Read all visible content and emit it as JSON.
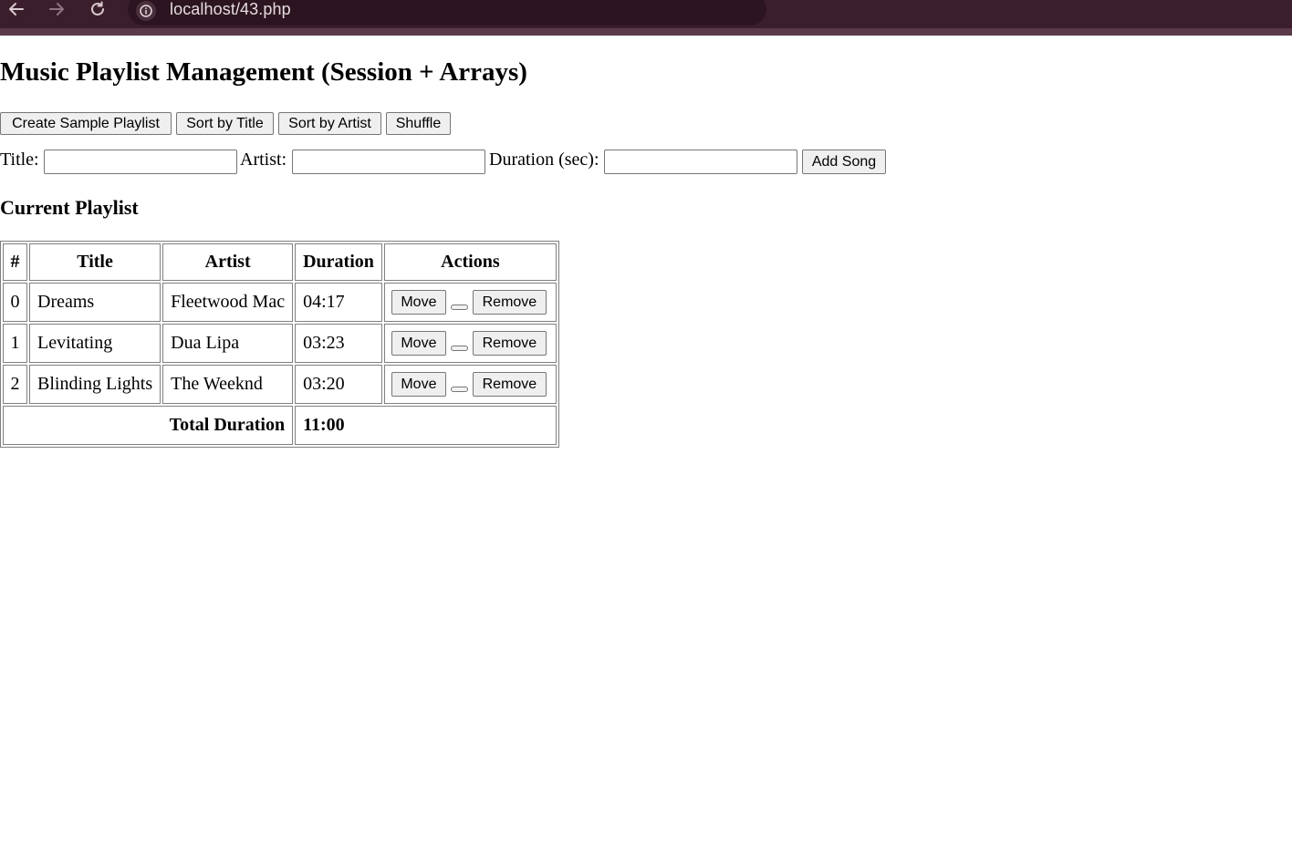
{
  "browser": {
    "url": "localhost/43.php"
  },
  "page": {
    "heading": "Music Playlist Management (Session + Arrays)",
    "toolbar": {
      "create_sample": "Create Sample Playlist",
      "sort_title": "Sort by Title",
      "sort_artist": "Sort by Artist",
      "shuffle": "Shuffle"
    },
    "form": {
      "title_label": "Title:",
      "title_value": "",
      "artist_label": "Artist:",
      "artist_value": "",
      "duration_label": "Duration (sec):",
      "duration_value": "",
      "add_label": "Add Song"
    },
    "playlist_heading": "Current Playlist",
    "table": {
      "headers": {
        "idx": "#",
        "title": "Title",
        "artist": "Artist",
        "duration": "Duration",
        "actions": "Actions"
      },
      "rows": [
        {
          "idx": "0",
          "title": "Dreams",
          "artist": "Fleetwood Mac",
          "duration": "04:17",
          "move": "Move",
          "position": "",
          "remove": "Remove"
        },
        {
          "idx": "1",
          "title": "Levitating",
          "artist": "Dua Lipa",
          "duration": "03:23",
          "move": "Move",
          "position": "",
          "remove": "Remove"
        },
        {
          "idx": "2",
          "title": "Blinding Lights",
          "artist": "The Weeknd",
          "duration": "03:20",
          "move": "Move",
          "position": "",
          "remove": "Remove"
        }
      ],
      "total_label": "Total Duration",
      "total_value": "11:00"
    }
  },
  "icons": {
    "back": "arrow-left-icon",
    "forward": "arrow-right-icon",
    "reload": "reload-icon",
    "site_info": "info-icon"
  },
  "colors": {
    "chrome_bg": "#3b1e2c",
    "address_bg": "#2c1520"
  }
}
